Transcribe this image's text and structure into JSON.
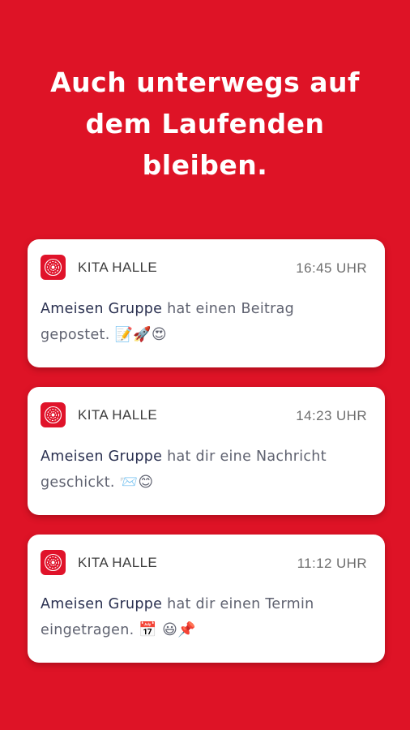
{
  "headline": {
    "line1": "Auch unterwegs auf",
    "line2": "dem Laufenden",
    "line3": "bleiben."
  },
  "colors": {
    "background": "#DE1326",
    "card": "#FFFFFF",
    "app_icon": "#E0132A"
  },
  "notifications": [
    {
      "app_name": "KITA HALLE",
      "time": "16:45 UHR",
      "sender": "Ameisen Gruppe",
      "text_line1": " hat einen Beitrag",
      "text_line2": "gepostet. ",
      "emojis": "📝🚀😍",
      "icon": "app-logo-icon"
    },
    {
      "app_name": "KITA HALLE",
      "time": "14:23 UHR",
      "sender": "Ameisen Gruppe",
      "text_line1": " hat dir eine Nachricht",
      "text_line2": "geschickt. ",
      "emojis": "📨😊",
      "icon": "app-logo-icon"
    },
    {
      "app_name": "KITA HALLE",
      "time": "11:12 UHR",
      "sender": "Ameisen Gruppe",
      "text_line1": " hat dir einen Termin",
      "text_line2": "eingetragen. ",
      "emojis": "📅 😃📌",
      "icon": "app-logo-icon"
    }
  ]
}
